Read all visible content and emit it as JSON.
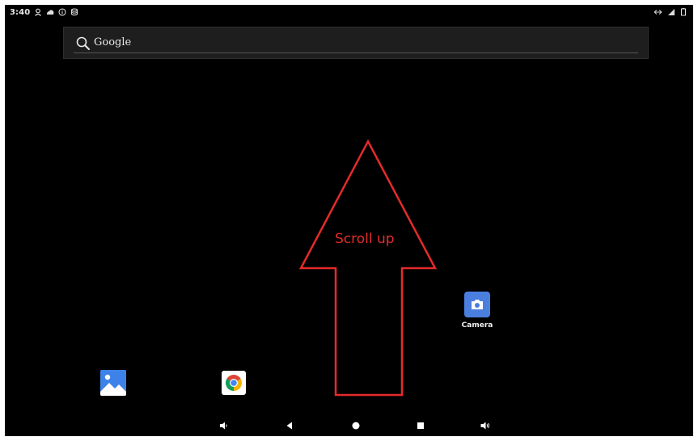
{
  "status_bar": {
    "time": "3:40",
    "left_icons": [
      "account-icon",
      "cloud-icon",
      "info-icon",
      "database-icon"
    ],
    "right_icons": [
      "data-transfer-icon",
      "wifi-icon",
      "signal-icon"
    ]
  },
  "search": {
    "label": "Google"
  },
  "annotation": {
    "text": "Scroll up",
    "color": "#e52b2b"
  },
  "apps": {
    "camera": {
      "label": "Camera"
    },
    "gallery": {
      "label": ""
    },
    "chrome": {
      "label": ""
    }
  },
  "nav_bar": {
    "buttons": [
      "volume-down-icon",
      "back-icon",
      "home-icon",
      "recents-icon",
      "volume-up-icon"
    ]
  },
  "colors": {
    "background": "#000000",
    "camera_blue": "#4a7fe0",
    "arrow_red": "#e52b2b"
  }
}
